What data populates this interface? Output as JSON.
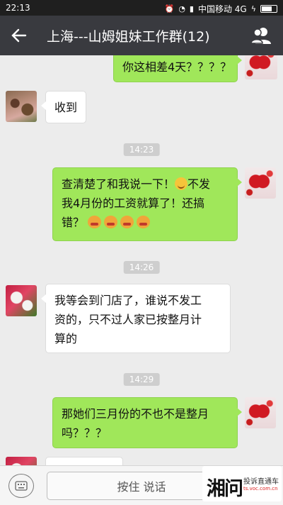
{
  "status_bar": {
    "time": "22:13",
    "carrier": "中国移动 4G"
  },
  "header": {
    "title": "上海---山姆姐妹工作群(12)",
    "back_icon": "back-arrow-icon",
    "members_icon": "group-members-icon",
    "background": "#393a3f"
  },
  "messages": [
    {
      "type": "out",
      "text": "你这相差4天？？？？"
    },
    {
      "type": "in",
      "text": "收到"
    },
    {
      "type": "time",
      "text": "14:23"
    },
    {
      "type": "out",
      "line1": "查清楚了和我说一下！",
      "line1b": "不发",
      "line2": "我4月份的工资就算了！还搞",
      "line3": "错？"
    },
    {
      "type": "time",
      "text": "14:26"
    },
    {
      "type": "in",
      "line1": "我等会到门店了，谁说不发工",
      "line2": "资的，只不过人家已按整月计",
      "line3": "算的"
    },
    {
      "type": "time",
      "text": "14:29"
    },
    {
      "type": "out",
      "line1": "那她们三月份的不也不是整月",
      "line2": "吗？？？"
    }
  ],
  "input_bar": {
    "hold_to_talk_label": "按住 说话",
    "keyboard_icon": "keyboard-icon"
  },
  "watermark": {
    "logo_text": "湘问",
    "line1": "投诉直通车",
    "line2": "ts.voc.com.cn"
  },
  "colors": {
    "outgoing_bubble": "#a0e75a",
    "incoming_bubble": "#ffffff",
    "chat_background": "#ececec"
  }
}
